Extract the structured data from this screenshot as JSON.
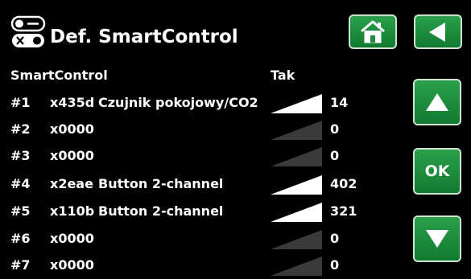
{
  "header": {
    "title": "Def. SmartControl",
    "title_icon": "smartcontrol-toggle-icon"
  },
  "nav": {
    "home_icon": "home-icon",
    "back_icon": "back-arrow-icon",
    "up_icon": "up-arrow-icon",
    "ok_label": "OK",
    "down_icon": "down-arrow-icon"
  },
  "colors": {
    "accent": "#1f8c3f",
    "signal_active": "#ffffff",
    "signal_inactive": "#3a3a3a"
  },
  "table": {
    "col_name": "SmartControl",
    "col_signal": "Tak",
    "rows": [
      {
        "num": "#1",
        "addr": "x435d",
        "desc": "Czujnik pokojowy/CO2",
        "value": "14",
        "active": true
      },
      {
        "num": "#2",
        "addr": "x0000",
        "desc": "",
        "value": "0",
        "active": false
      },
      {
        "num": "#3",
        "addr": "x0000",
        "desc": "",
        "value": "0",
        "active": false
      },
      {
        "num": "#4",
        "addr": "x2eae",
        "desc": "Button 2-channel",
        "value": "402",
        "active": true
      },
      {
        "num": "#5",
        "addr": "x110b",
        "desc": "Button 2-channel",
        "value": "321",
        "active": true
      },
      {
        "num": "#6",
        "addr": "x0000",
        "desc": "",
        "value": "0",
        "active": false
      },
      {
        "num": "#7",
        "addr": "x0000",
        "desc": "",
        "value": "0",
        "active": false
      }
    ]
  }
}
